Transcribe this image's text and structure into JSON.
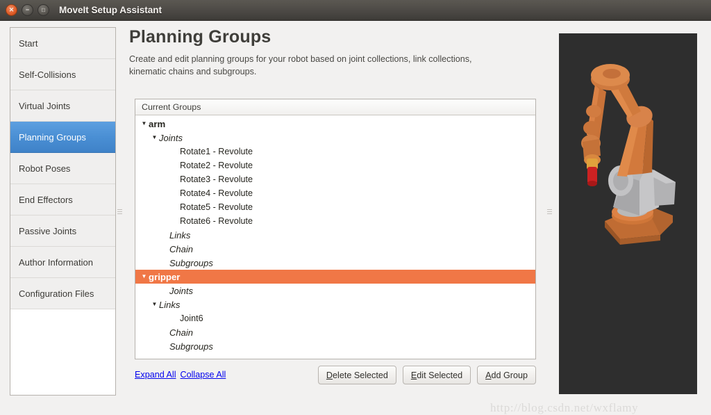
{
  "window": {
    "title": "MoveIt Setup Assistant",
    "controls": [
      {
        "name": "close",
        "glyph": "✕"
      },
      {
        "name": "minimize",
        "glyph": "−"
      },
      {
        "name": "maximize",
        "glyph": "□"
      }
    ]
  },
  "sidebar": {
    "items": [
      {
        "label": "Start",
        "selected": false
      },
      {
        "label": "Self-Collisions",
        "selected": false
      },
      {
        "label": "Virtual Joints",
        "selected": false
      },
      {
        "label": "Planning Groups",
        "selected": true
      },
      {
        "label": "Robot Poses",
        "selected": false
      },
      {
        "label": "End Effectors",
        "selected": false
      },
      {
        "label": "Passive Joints",
        "selected": false
      },
      {
        "label": "Author Information",
        "selected": false
      },
      {
        "label": "Configuration Files",
        "selected": false
      }
    ]
  },
  "main": {
    "title": "Planning Groups",
    "description": "Create and edit planning groups for your robot based on joint collections, link collections, kinematic chains and subgroups.",
    "tree": {
      "header": "Current Groups",
      "rows": [
        {
          "label": "arm",
          "level": 0,
          "style": "group",
          "arrow": "down",
          "selected": false
        },
        {
          "label": "Joints",
          "level": 1,
          "style": "category",
          "arrow": "down",
          "selected": false
        },
        {
          "label": "Rotate1 - Revolute",
          "level": 3,
          "style": "leaf",
          "arrow": "none",
          "selected": false
        },
        {
          "label": "Rotate2 - Revolute",
          "level": 3,
          "style": "leaf",
          "arrow": "none",
          "selected": false
        },
        {
          "label": "Rotate3 - Revolute",
          "level": 3,
          "style": "leaf",
          "arrow": "none",
          "selected": false
        },
        {
          "label": "Rotate4 - Revolute",
          "level": 3,
          "style": "leaf",
          "arrow": "none",
          "selected": false
        },
        {
          "label": "Rotate5 - Revolute",
          "level": 3,
          "style": "leaf",
          "arrow": "none",
          "selected": false
        },
        {
          "label": "Rotate6 - Revolute",
          "level": 3,
          "style": "leaf",
          "arrow": "none",
          "selected": false
        },
        {
          "label": "Links",
          "level": 2,
          "style": "category",
          "arrow": "none",
          "selected": false
        },
        {
          "label": "Chain",
          "level": 2,
          "style": "category",
          "arrow": "none",
          "selected": false
        },
        {
          "label": "Subgroups",
          "level": 2,
          "style": "category",
          "arrow": "none",
          "selected": false
        },
        {
          "label": "gripper",
          "level": 0,
          "style": "group",
          "arrow": "down",
          "selected": true
        },
        {
          "label": "Joints",
          "level": 2,
          "style": "category",
          "arrow": "none",
          "selected": false
        },
        {
          "label": "Links",
          "level": 1,
          "style": "category",
          "arrow": "down",
          "selected": false
        },
        {
          "label": "Joint6",
          "level": 3,
          "style": "leaf",
          "arrow": "none",
          "selected": false
        },
        {
          "label": "Chain",
          "level": 2,
          "style": "category",
          "arrow": "none",
          "selected": false
        },
        {
          "label": "Subgroups",
          "level": 2,
          "style": "category",
          "arrow": "none",
          "selected": false
        }
      ]
    },
    "links": [
      {
        "label": "Expand All"
      },
      {
        "label": "Collapse All"
      }
    ],
    "buttons": [
      {
        "label": "Delete Selected",
        "accel": "D"
      },
      {
        "label": "Edit Selected",
        "accel": "E"
      },
      {
        "label": "Add Group",
        "accel": "A"
      }
    ]
  },
  "viewport": {
    "background_color": "#2e2e2e",
    "robot_color": "#d1763a",
    "robot_secondary_color": "#b0b0b0",
    "tool_color": "#cc2222"
  },
  "watermark": "http://blog.csdn.net/wxflamy",
  "colors": {
    "selection_blue": "#4a8fd4",
    "selection_orange": "#f07746",
    "link_blue": "#0000ee",
    "titlebar": "#4c4945"
  }
}
